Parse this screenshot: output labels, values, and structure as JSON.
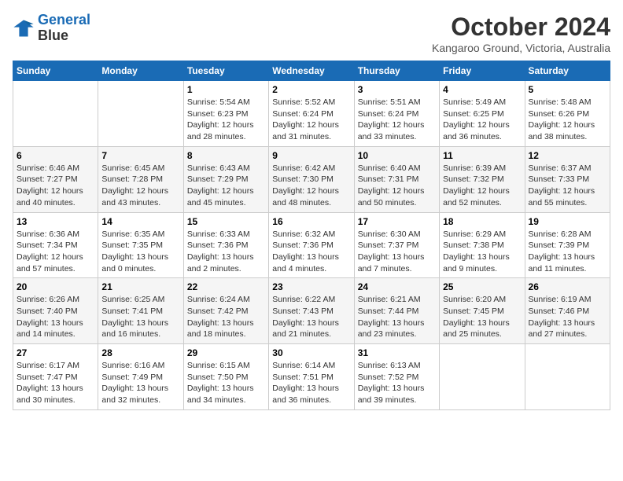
{
  "logo": {
    "line1": "General",
    "line2": "Blue"
  },
  "title": "October 2024",
  "subtitle": "Kangaroo Ground, Victoria, Australia",
  "days_of_week": [
    "Sunday",
    "Monday",
    "Tuesday",
    "Wednesday",
    "Thursday",
    "Friday",
    "Saturday"
  ],
  "weeks": [
    [
      {
        "day": "",
        "info": ""
      },
      {
        "day": "",
        "info": ""
      },
      {
        "day": "1",
        "info": "Sunrise: 5:54 AM\nSunset: 6:23 PM\nDaylight: 12 hours and 28 minutes."
      },
      {
        "day": "2",
        "info": "Sunrise: 5:52 AM\nSunset: 6:24 PM\nDaylight: 12 hours and 31 minutes."
      },
      {
        "day": "3",
        "info": "Sunrise: 5:51 AM\nSunset: 6:24 PM\nDaylight: 12 hours and 33 minutes."
      },
      {
        "day": "4",
        "info": "Sunrise: 5:49 AM\nSunset: 6:25 PM\nDaylight: 12 hours and 36 minutes."
      },
      {
        "day": "5",
        "info": "Sunrise: 5:48 AM\nSunset: 6:26 PM\nDaylight: 12 hours and 38 minutes."
      }
    ],
    [
      {
        "day": "6",
        "info": "Sunrise: 6:46 AM\nSunset: 7:27 PM\nDaylight: 12 hours and 40 minutes."
      },
      {
        "day": "7",
        "info": "Sunrise: 6:45 AM\nSunset: 7:28 PM\nDaylight: 12 hours and 43 minutes."
      },
      {
        "day": "8",
        "info": "Sunrise: 6:43 AM\nSunset: 7:29 PM\nDaylight: 12 hours and 45 minutes."
      },
      {
        "day": "9",
        "info": "Sunrise: 6:42 AM\nSunset: 7:30 PM\nDaylight: 12 hours and 48 minutes."
      },
      {
        "day": "10",
        "info": "Sunrise: 6:40 AM\nSunset: 7:31 PM\nDaylight: 12 hours and 50 minutes."
      },
      {
        "day": "11",
        "info": "Sunrise: 6:39 AM\nSunset: 7:32 PM\nDaylight: 12 hours and 52 minutes."
      },
      {
        "day": "12",
        "info": "Sunrise: 6:37 AM\nSunset: 7:33 PM\nDaylight: 12 hours and 55 minutes."
      }
    ],
    [
      {
        "day": "13",
        "info": "Sunrise: 6:36 AM\nSunset: 7:34 PM\nDaylight: 12 hours and 57 minutes."
      },
      {
        "day": "14",
        "info": "Sunrise: 6:35 AM\nSunset: 7:35 PM\nDaylight: 13 hours and 0 minutes."
      },
      {
        "day": "15",
        "info": "Sunrise: 6:33 AM\nSunset: 7:36 PM\nDaylight: 13 hours and 2 minutes."
      },
      {
        "day": "16",
        "info": "Sunrise: 6:32 AM\nSunset: 7:36 PM\nDaylight: 13 hours and 4 minutes."
      },
      {
        "day": "17",
        "info": "Sunrise: 6:30 AM\nSunset: 7:37 PM\nDaylight: 13 hours and 7 minutes."
      },
      {
        "day": "18",
        "info": "Sunrise: 6:29 AM\nSunset: 7:38 PM\nDaylight: 13 hours and 9 minutes."
      },
      {
        "day": "19",
        "info": "Sunrise: 6:28 AM\nSunset: 7:39 PM\nDaylight: 13 hours and 11 minutes."
      }
    ],
    [
      {
        "day": "20",
        "info": "Sunrise: 6:26 AM\nSunset: 7:40 PM\nDaylight: 13 hours and 14 minutes."
      },
      {
        "day": "21",
        "info": "Sunrise: 6:25 AM\nSunset: 7:41 PM\nDaylight: 13 hours and 16 minutes."
      },
      {
        "day": "22",
        "info": "Sunrise: 6:24 AM\nSunset: 7:42 PM\nDaylight: 13 hours and 18 minutes."
      },
      {
        "day": "23",
        "info": "Sunrise: 6:22 AM\nSunset: 7:43 PM\nDaylight: 13 hours and 21 minutes."
      },
      {
        "day": "24",
        "info": "Sunrise: 6:21 AM\nSunset: 7:44 PM\nDaylight: 13 hours and 23 minutes."
      },
      {
        "day": "25",
        "info": "Sunrise: 6:20 AM\nSunset: 7:45 PM\nDaylight: 13 hours and 25 minutes."
      },
      {
        "day": "26",
        "info": "Sunrise: 6:19 AM\nSunset: 7:46 PM\nDaylight: 13 hours and 27 minutes."
      }
    ],
    [
      {
        "day": "27",
        "info": "Sunrise: 6:17 AM\nSunset: 7:47 PM\nDaylight: 13 hours and 30 minutes."
      },
      {
        "day": "28",
        "info": "Sunrise: 6:16 AM\nSunset: 7:49 PM\nDaylight: 13 hours and 32 minutes."
      },
      {
        "day": "29",
        "info": "Sunrise: 6:15 AM\nSunset: 7:50 PM\nDaylight: 13 hours and 34 minutes."
      },
      {
        "day": "30",
        "info": "Sunrise: 6:14 AM\nSunset: 7:51 PM\nDaylight: 13 hours and 36 minutes."
      },
      {
        "day": "31",
        "info": "Sunrise: 6:13 AM\nSunset: 7:52 PM\nDaylight: 13 hours and 39 minutes."
      },
      {
        "day": "",
        "info": ""
      },
      {
        "day": "",
        "info": ""
      }
    ]
  ]
}
